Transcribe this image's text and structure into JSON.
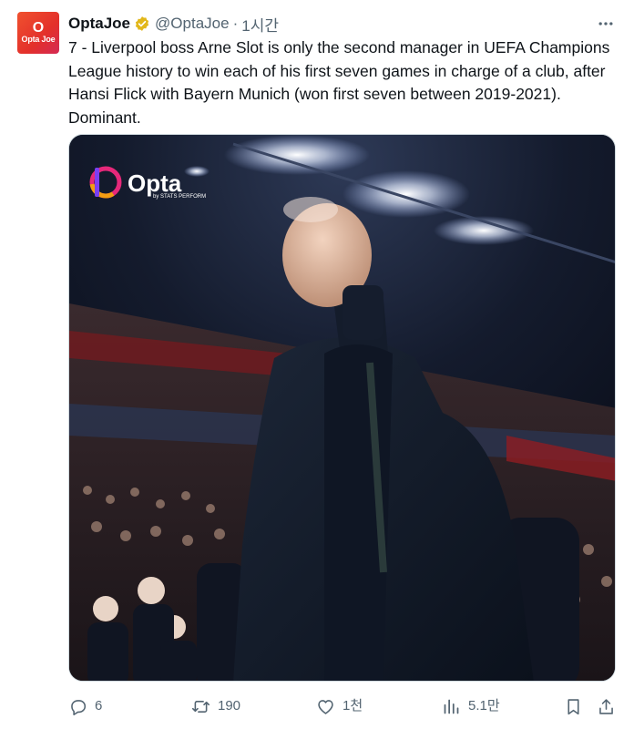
{
  "tweet": {
    "avatar_text_top": "O",
    "avatar_text_bottom": "Opta Joe",
    "display_name": "OptaJoe",
    "handle": "@OptaJoe",
    "separator": "·",
    "time": "1시간",
    "text": "7 - Liverpool boss Arne Slot is only the second manager in UEFA Champions League history to win each of his first seven games in charge of a club, after Hansi Flick with Bayern Munich (won first seven between 2019-2021). Dominant.",
    "media": {
      "logo_text": "Opta",
      "logo_sub": "by STATS PERFORM",
      "logo_colors": [
        "#7b3ff2",
        "#e6287a",
        "#f39c12"
      ]
    },
    "actions": {
      "reply_count": "6",
      "retweet_count": "190",
      "like_count": "1천",
      "views_count": "5.1만"
    }
  },
  "colors": {
    "text": "#0f1419",
    "secondary": "#536471",
    "verified_badge": "#e2b719"
  }
}
